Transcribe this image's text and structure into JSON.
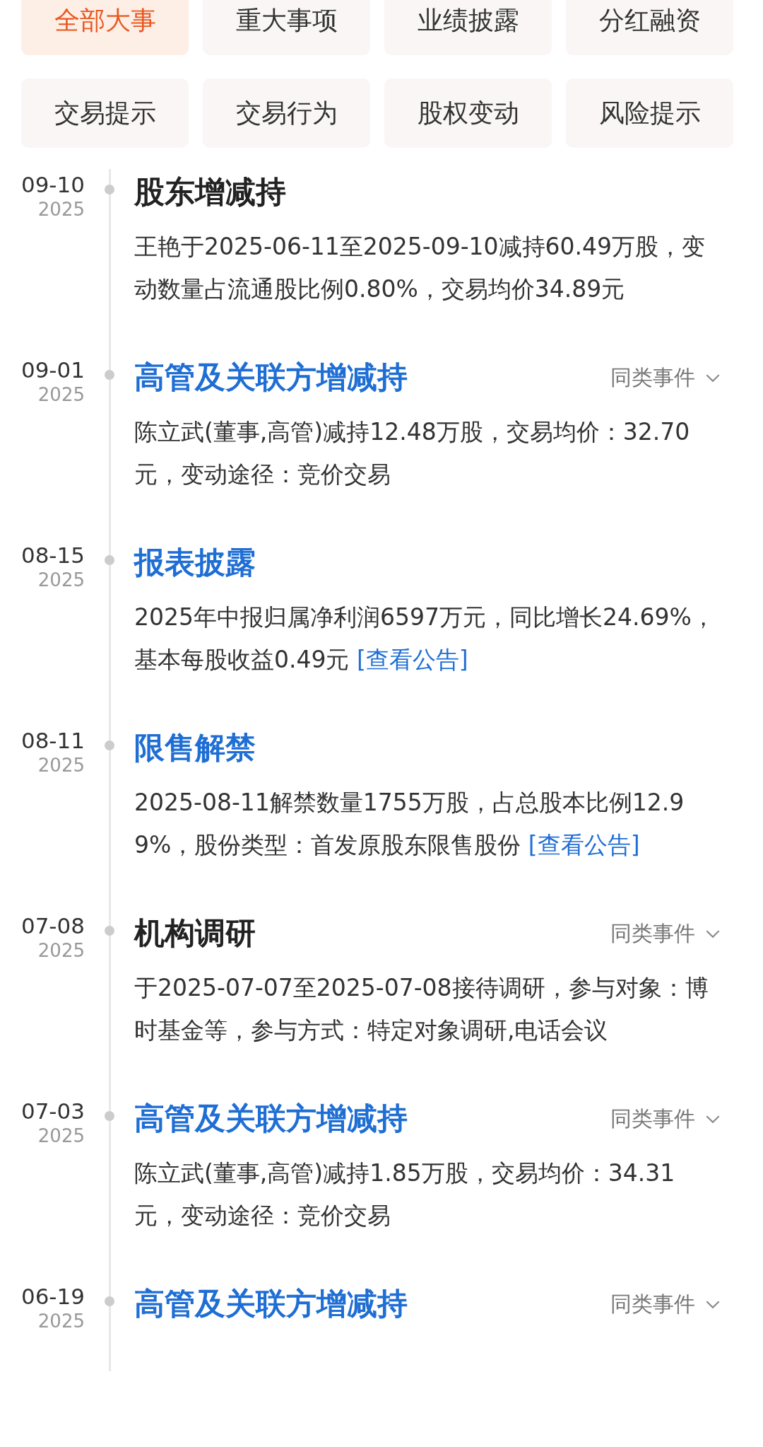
{
  "tabs": [
    {
      "label": "全部大事",
      "selected": true
    },
    {
      "label": "重大事项",
      "selected": false
    },
    {
      "label": "业绩披露",
      "selected": false
    },
    {
      "label": "分红融资",
      "selected": false
    },
    {
      "label": "交易提示",
      "selected": false
    },
    {
      "label": "交易行为",
      "selected": false
    },
    {
      "label": "股权变动",
      "selected": false
    },
    {
      "label": "风险提示",
      "selected": false
    }
  ],
  "events": [
    {
      "date": "09-10",
      "year": "2025",
      "title": "股东增减持",
      "linked": false,
      "body": "王艳于2025-06-11至2025-09-10减持60.49万股，变动数量占流通股比例0.80%，交易均价34.89元"
    },
    {
      "date": "09-01",
      "year": "2025",
      "title": "高管及关联方增减持",
      "linked": true,
      "similar": "同类事件",
      "body": "陈立武(董事,高管)减持12.48万股，交易均价：32.70元，变动途径：竞价交易"
    },
    {
      "date": "08-15",
      "year": "2025",
      "title": "报表披露",
      "linked": true,
      "body": "2025年中报归属净利润6597万元，同比增长24.69%，基本每股收益0.49元",
      "link": "[查看公告]"
    },
    {
      "date": "08-11",
      "year": "2025",
      "title": "限售解禁",
      "linked": true,
      "body": "2025-08-11解禁数量1755万股，占总股本比例12.99%，股份类型：首发原股东限售股份",
      "link": "[查看公告]"
    },
    {
      "date": "07-08",
      "year": "2025",
      "title": "机构调研",
      "linked": false,
      "similar": "同类事件",
      "body": "于2025-07-07至2025-07-08接待调研，参与对象：博时基金等，参与方式：特定对象调研,电话会议"
    },
    {
      "date": "07-03",
      "year": "2025",
      "title": "高管及关联方增减持",
      "linked": true,
      "similar": "同类事件",
      "body": "陈立武(董事,高管)减持1.85万股，交易均价：34.31元，变动途径：竞价交易"
    },
    {
      "date": "06-19",
      "year": "2025",
      "title": "高管及关联方增减持",
      "linked": true,
      "similar": "同类事件"
    }
  ]
}
